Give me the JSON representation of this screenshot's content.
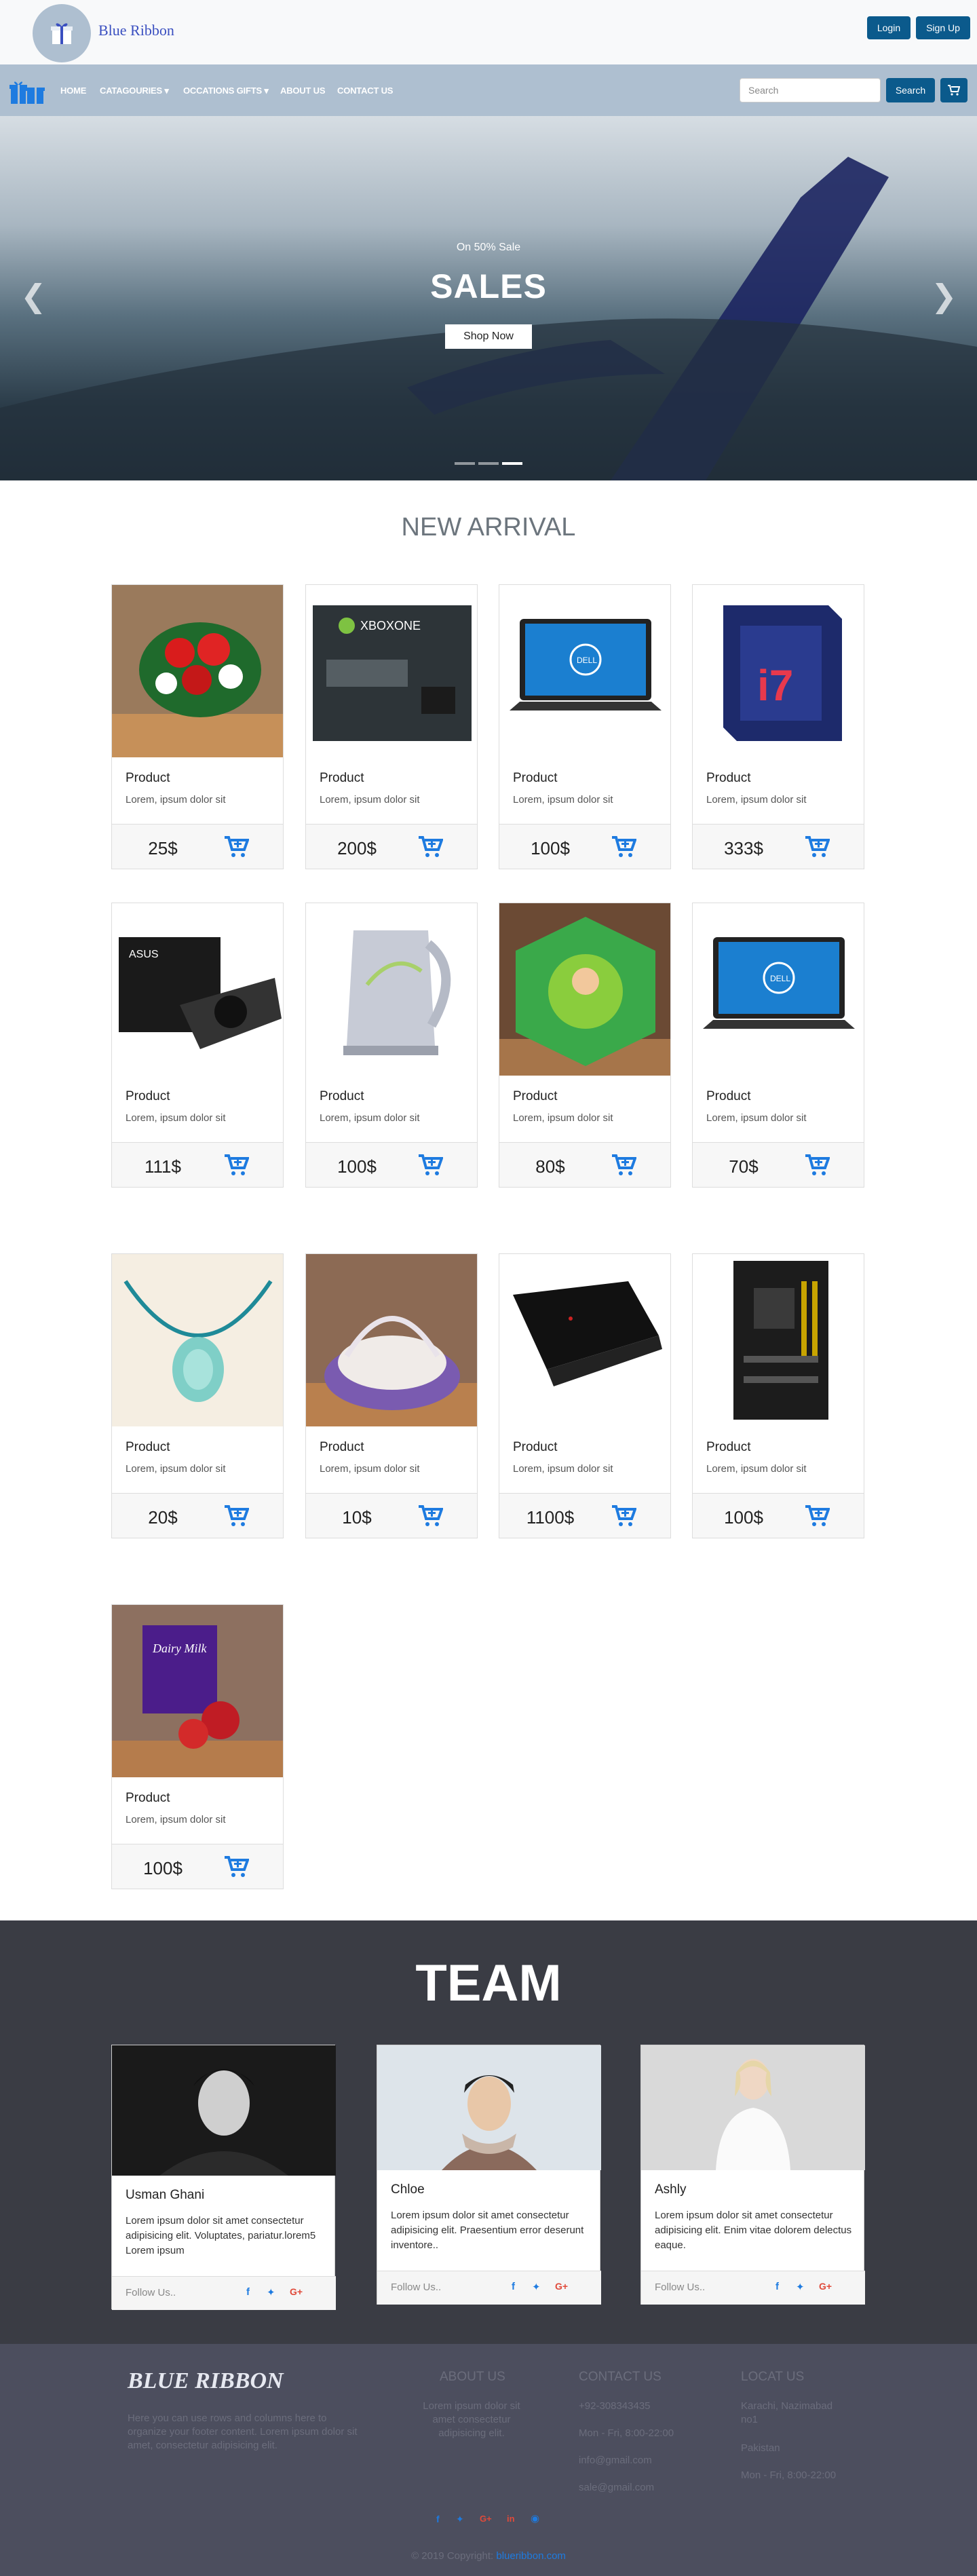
{
  "brand": {
    "name": "Blue Ribbon",
    "footer_name": "BLUE RIBBON"
  },
  "header": {
    "login_label": "Login",
    "signup_label": "Sign Up"
  },
  "nav": {
    "items": [
      {
        "label": "HOME"
      },
      {
        "label": "CATAGOURIES ▾"
      },
      {
        "label": "OCCATIONS GIFTS ▾"
      },
      {
        "label": "ABOUT US"
      },
      {
        "label": "CONTACT US"
      }
    ],
    "search_placeholder": "Search",
    "search_button": "Search"
  },
  "hero": {
    "subtitle": "On 50% Sale",
    "title": "SALES",
    "button": "Shop Now",
    "active_slide": 3,
    "slide_count": 3
  },
  "arrivals": {
    "title": "NEW ARRIVAL",
    "products": [
      {
        "name": "Product",
        "desc": "Lorem, ipsum dolor sit",
        "price": "25$",
        "image": "flower-bouquet"
      },
      {
        "name": "Product",
        "desc": "Lorem, ipsum dolor sit",
        "price": "200$",
        "image": "xbox-one-box"
      },
      {
        "name": "Product",
        "desc": "Lorem, ipsum dolor sit",
        "price": "100$",
        "image": "dell-laptop"
      },
      {
        "name": "Product",
        "desc": "Lorem, ipsum dolor sit",
        "price": "333$",
        "image": "intel-core-i7-box"
      },
      {
        "name": "Product",
        "desc": "Lorem, ipsum dolor sit",
        "price": "111$",
        "image": "asus-graphics-card"
      },
      {
        "name": "Product",
        "desc": "Lorem, ipsum dolor sit",
        "price": "100$",
        "image": "electric-kettle"
      },
      {
        "name": "Product",
        "desc": "Lorem, ipsum dolor sit",
        "price": "80$",
        "image": "ben10-gift-box"
      },
      {
        "name": "Product",
        "desc": "Lorem, ipsum dolor sit",
        "price": "70$",
        "image": "dell-laptop"
      },
      {
        "name": "Product",
        "desc": "Lorem, ipsum dolor sit",
        "price": "20$",
        "image": "stone-necklace"
      },
      {
        "name": "Product",
        "desc": "Lorem, ipsum dolor sit",
        "price": "10$",
        "image": "gift-basket"
      },
      {
        "name": "Product",
        "desc": "Lorem, ipsum dolor sit",
        "price": "1100$",
        "image": "black-laptop"
      },
      {
        "name": "Product",
        "desc": "Lorem, ipsum dolor sit",
        "price": "100$",
        "image": "motherboard"
      },
      {
        "name": "Product",
        "desc": "Lorem, ipsum dolor sit",
        "price": "100$",
        "image": "dairy-milk-roses"
      }
    ]
  },
  "team": {
    "title": "TEAM",
    "members": [
      {
        "name": "Usman Ghani",
        "bio": "Lorem ipsum dolor sit amet consectetur adipisicing elit. Voluptates, pariatur.lorem5 Lorem ipsum",
        "follow": "Follow Us.."
      },
      {
        "name": "Chloe",
        "bio": "Lorem ipsum dolor sit amet consectetur adipisicing elit. Praesentium error deserunt inventore..",
        "follow": "Follow Us.."
      },
      {
        "name": "Ashly",
        "bio": "Lorem ipsum dolor sit amet consectetur adipisicing elit. Enim vitae dolorem delectus eaque.",
        "follow": "Follow Us.."
      }
    ]
  },
  "footer": {
    "about_text": "Here you can use rows and columns here to organize your footer content. Lorem ipsum dolor sit amet, consectetur adipisicing elit.",
    "about_us": {
      "heading": "ABOUT US",
      "text": "Lorem ipsum dolor sit amet consectetur adipisicing elit."
    },
    "contact_us": {
      "heading": "CONTACT US",
      "phone": "+92-308343435",
      "hours": "Mon - Fri, 8:00-22:00",
      "email1": "info@gmail.com",
      "email2": "sale@gmail.com"
    },
    "location": {
      "heading": "LOCAT US",
      "address": "Karachi, Nazimabad no1",
      "country": "Pakistan",
      "hours": "Mon - Fri, 8:00-22:00"
    },
    "copyright": "© 2019 Copyright:",
    "copyright_link": "blueribbon.com"
  },
  "colors": {
    "primary": "#0b5a8c",
    "nav": "#aebfd0",
    "accent": "#1e7be0",
    "team_bg": "#3a3c44",
    "footer_bg": "#4c4e5e"
  }
}
